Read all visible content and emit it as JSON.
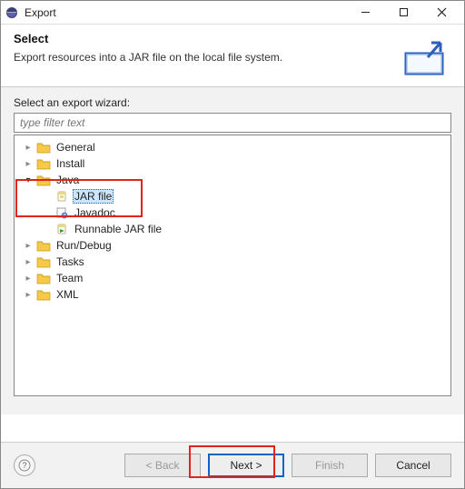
{
  "window": {
    "title": "Export"
  },
  "header": {
    "title": "Select",
    "desc": "Export resources into a JAR file on the local file system."
  },
  "body": {
    "label": "Select an export wizard:",
    "filter_placeholder": "type filter text"
  },
  "tree": {
    "items": [
      {
        "label": "General",
        "expanded": false,
        "type": "folder",
        "depth": 0
      },
      {
        "label": "Install",
        "expanded": false,
        "type": "folder",
        "depth": 0
      },
      {
        "label": "Java",
        "expanded": true,
        "type": "folder",
        "depth": 0
      },
      {
        "label": "JAR file",
        "type": "jar",
        "selected": true,
        "depth": 1
      },
      {
        "label": "Javadoc",
        "type": "javadoc",
        "depth": 1
      },
      {
        "label": "Runnable JAR file",
        "type": "runjar",
        "depth": 1
      },
      {
        "label": "Run/Debug",
        "expanded": false,
        "type": "folder",
        "depth": 0
      },
      {
        "label": "Tasks",
        "expanded": false,
        "type": "folder",
        "depth": 0
      },
      {
        "label": "Team",
        "expanded": false,
        "type": "folder",
        "depth": 0
      },
      {
        "label": "XML",
        "expanded": false,
        "type": "folder",
        "depth": 0
      }
    ]
  },
  "footer": {
    "back": "< Back",
    "next": "Next >",
    "finish": "Finish",
    "cancel": "Cancel"
  }
}
